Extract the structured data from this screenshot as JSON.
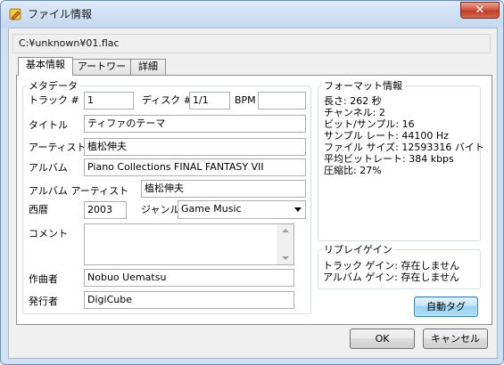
{
  "window": {
    "title": "ファイル情報",
    "close_label": "✕"
  },
  "file_path": "C:¥unknown¥01.flac",
  "tabs": [
    "基本情報",
    "アートワーク",
    "詳細"
  ],
  "metadata": {
    "legend": "メタデータ",
    "track_label": "トラック #",
    "track_value": "1",
    "disc_label": "ディスク #",
    "disc_value": "1/1",
    "bpm_label": "BPM",
    "bpm_value": "",
    "title_label": "タイトル",
    "title_value": "ティファのテーマ",
    "artist_label": "アーティスト",
    "artist_value": "植松伸夫",
    "album_label": "アルバム",
    "album_value": "Piano Collections FINAL FANTASY VII",
    "album_artist_label": "アルバム アーティスト",
    "album_artist_value": "植松伸夫",
    "year_label": "西暦",
    "year_value": "2003",
    "genre_label": "ジャンル",
    "genre_value": "Game Music",
    "comment_label": "コメント",
    "comment_value": "",
    "composer_label": "作曲者",
    "composer_value": "Nobuo Uematsu",
    "publisher_label": "発行者",
    "publisher_value": "DigiCube"
  },
  "format_info": {
    "legend": "フォーマット情報",
    "lines": [
      "長さ: 262 秒",
      "チャンネル: 2",
      "ビット/サンプル: 16",
      "サンプル レート: 44100 Hz",
      "ファイル サイズ: 12593316 バイト",
      "平均ビットレート: 384 kbps",
      "圧縮比: 27%"
    ]
  },
  "replay_gain": {
    "legend": "リプレイゲイン",
    "lines": [
      "トラック ゲイン: 存在しません",
      "アルバム ゲイン: 存在しません"
    ]
  },
  "buttons": {
    "auto_tag": "自動タグ",
    "ok": "OK",
    "cancel": "キャンセル"
  },
  "colors": {
    "title_bar": "#c5d9f1",
    "close_button": "#c13c28",
    "default_button": "#98d1ef",
    "dialog_bg": "#f0f0f0"
  }
}
